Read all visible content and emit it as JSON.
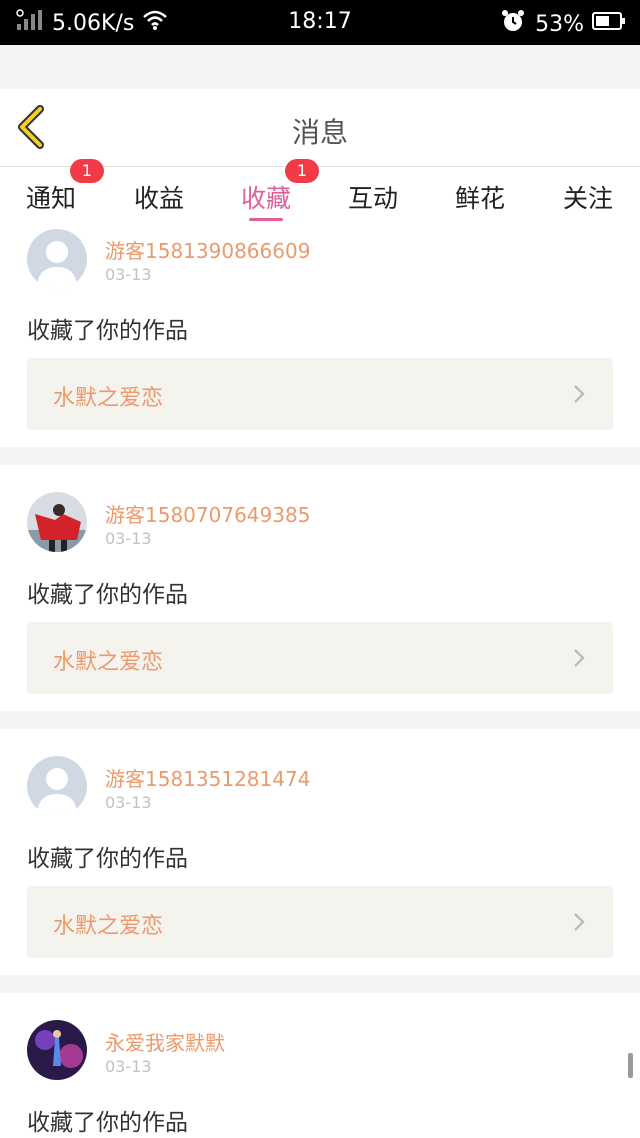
{
  "status_bar": {
    "speed": "5.06K/s",
    "time": "18:17",
    "battery": "53%",
    "icons": [
      "signal-icon",
      "wifi-icon",
      "alarm-icon",
      "battery-icon"
    ]
  },
  "header": {
    "title": "消息",
    "back_icon": "chevron-left-icon",
    "accent": "#f5d020"
  },
  "tabs": [
    {
      "label": "通知",
      "badge": "1"
    },
    {
      "label": "收益",
      "badge": ""
    },
    {
      "label": "收藏",
      "badge": "1",
      "active": true
    },
    {
      "label": "互动",
      "badge": ""
    },
    {
      "label": "鲜花",
      "badge": ""
    },
    {
      "label": "关注",
      "badge": ""
    }
  ],
  "colors": {
    "active_tab": "#e2609a",
    "badge": "#f23b48",
    "username": "#eb9a6c",
    "work_title": "#eb9a6c"
  },
  "messages": [
    {
      "user": "游客1581390866609",
      "date": "03-13",
      "action": "收藏了你的作品",
      "work_title": "水默之爱恋",
      "avatar": "default-avatar"
    },
    {
      "user": "游客1580707649385",
      "date": "03-13",
      "action": "收藏了你的作品",
      "work_title": "水默之爱恋",
      "avatar": "photo-avatar"
    },
    {
      "user": "游客1581351281474",
      "date": "03-13",
      "action": "收藏了你的作品",
      "work_title": "水默之爱恋",
      "avatar": "default-avatar"
    },
    {
      "user": "永爱我家默默",
      "date": "03-13",
      "action": "收藏了你的作品",
      "work_title": "",
      "avatar": "photo-avatar"
    }
  ]
}
